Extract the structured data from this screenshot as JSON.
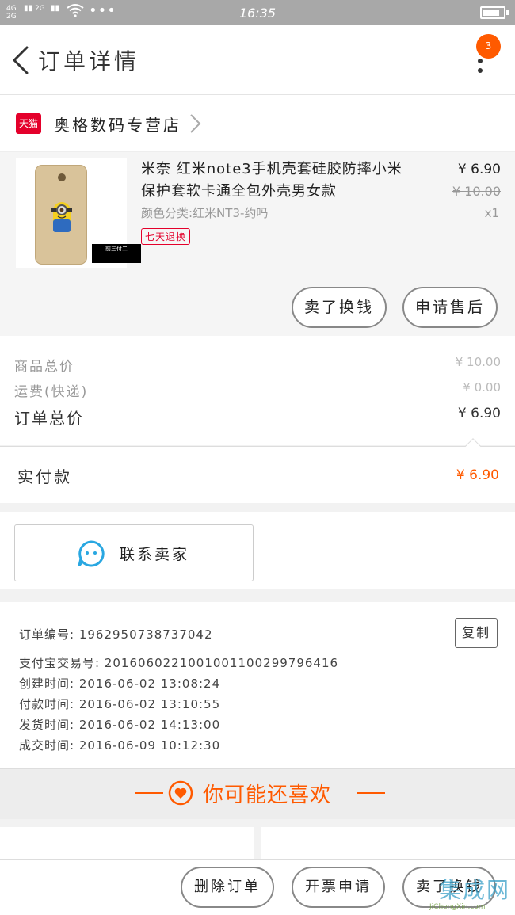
{
  "status_bar": {
    "network": [
      "4G",
      "2G",
      "2G"
    ],
    "time": "16:35",
    "battery_level": 0.85
  },
  "navbar": {
    "title": "订单详情",
    "notification_count": "3"
  },
  "shop": {
    "platform": "天猫",
    "name": "奥格数码专营店"
  },
  "product": {
    "image_caption": "前三付二",
    "title": "米奈 红米note3手机壳套硅胶防摔小米保护套软卡通全包外壳男女款",
    "sku": "颜色分类:红米NT3-约吗",
    "tag": "七天退换",
    "price": "¥ 6.90",
    "original_price": "¥ 10.00",
    "quantity": "x1",
    "buttons": {
      "sold": "卖了换钱",
      "after_sale": "申请售后"
    }
  },
  "summary": {
    "goods_total_label": "商品总价",
    "goods_total_value": "¥ 10.00",
    "shipping_label": "运费(快递)",
    "shipping_value": "¥ 0.00",
    "order_total_label": "订单总价",
    "order_total_value": "¥ 6.90",
    "paid_label": "实付款",
    "paid_value": "¥ 6.90"
  },
  "contact": {
    "label": "联系卖家"
  },
  "order_info": {
    "order_no": "订单编号: 1962950738737042",
    "alipay_no": "支付宝交易号: 2016060221001001100299796416",
    "created": "创建时间: 2016-06-02 13:08:24",
    "paid": "付款时间: 2016-06-02 13:10:55",
    "shipped": "发货时间: 2016-06-02 14:13:00",
    "completed": "成交时间: 2016-06-09 10:12:30",
    "copy_label": "复制"
  },
  "recommend": {
    "title": "你可能还喜欢"
  },
  "bottom_bar": {
    "delete": "删除订单",
    "invoice": "开票申请",
    "sell": "卖了换钱"
  },
  "watermark": {
    "main": "集成网",
    "sub": "JiChengXin.com"
  },
  "colors": {
    "accent": "#ff5a00",
    "tmall_red": "#e4002b",
    "status_bar": "#a8a8a8"
  }
}
